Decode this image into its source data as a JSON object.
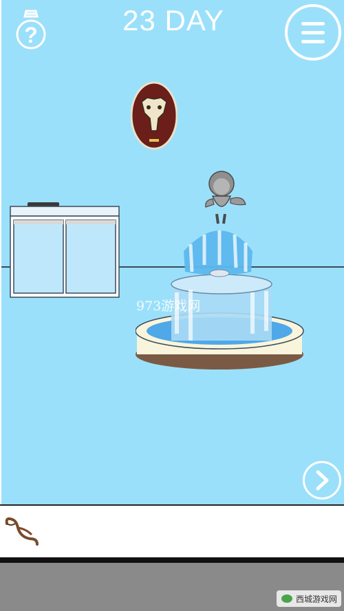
{
  "hud": {
    "day_label": "23 DAY",
    "hint_icon": "lightbulb-question-icon",
    "menu_icon": "hamburger-menu-icon",
    "next_icon": "chevron-right-icon"
  },
  "scene": {
    "objects": [
      "animal-skull-plaque",
      "cabinet",
      "tray",
      "fountain",
      "cherub-statue"
    ],
    "watermark": "973游戏网"
  },
  "inventory": {
    "items": [
      {
        "icon": "rope-icon"
      }
    ]
  },
  "branding": {
    "corner_logo": "西城游戏网"
  },
  "colors": {
    "sky": "#9be0fa",
    "water": "#4fa8e8",
    "inventory_bg": "#ffffff",
    "bottom_bar": "#8a8a8a"
  }
}
